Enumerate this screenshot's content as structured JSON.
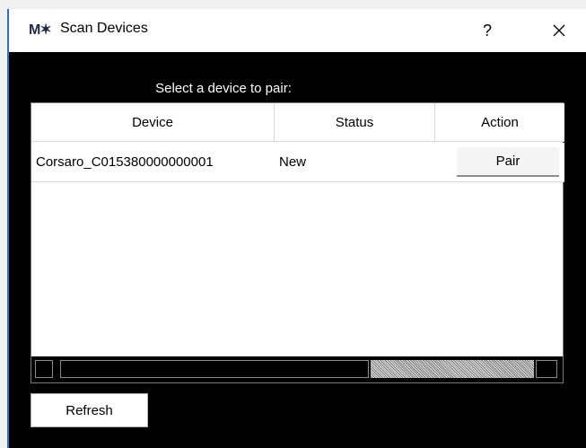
{
  "window": {
    "app_icon": "M✶",
    "title": "Scan Devices",
    "help_label": "?",
    "close_icon": "close-icon"
  },
  "prompt": "Select a device to pair:",
  "table": {
    "columns": [
      "Device",
      "Status",
      "Action"
    ],
    "rows": [
      {
        "device": "Corsaro_C015380000000001",
        "status": "New",
        "action": "Pair"
      }
    ]
  },
  "buttons": {
    "refresh": "Refresh"
  }
}
